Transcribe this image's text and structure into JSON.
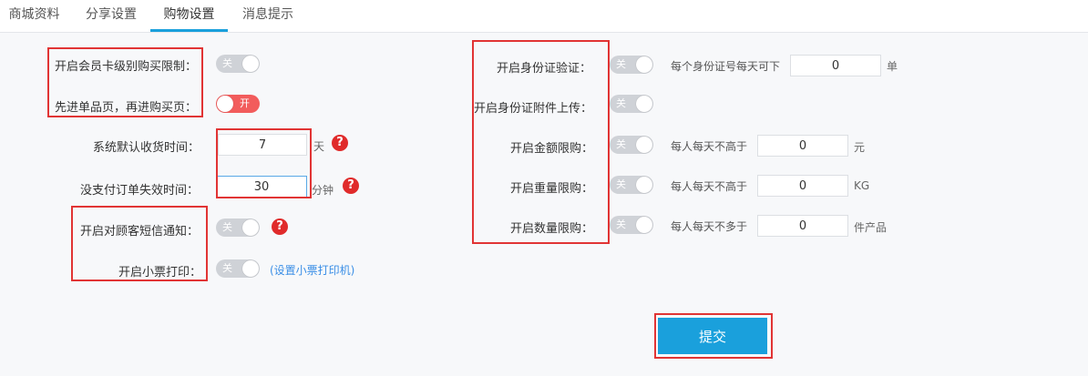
{
  "tabs": [
    {
      "label": "商城资料",
      "active": false
    },
    {
      "label": "分享设置",
      "active": false
    },
    {
      "label": "购物设置",
      "active": true
    },
    {
      "label": "消息提示",
      "active": false
    }
  ],
  "left": {
    "member_limit": {
      "label": "开启会员卡级别购买限制：",
      "toggle": "关",
      "state": "off"
    },
    "product_first": {
      "label": "先进单品页，再进购买页：",
      "toggle": "开",
      "state": "on"
    },
    "receive_time": {
      "label": "系统默认收货时间：",
      "value": "7",
      "unit": "天"
    },
    "unpaid_expire": {
      "label": "没支付订单失效时间：",
      "value": "30",
      "unit": "分钟"
    },
    "sms_notify": {
      "label": "开启对顾客短信通知：",
      "toggle": "关",
      "state": "off"
    },
    "receipt_print": {
      "label": "开启小票打印：",
      "toggle": "关",
      "state": "off",
      "link": "(设置小票打印机)"
    }
  },
  "right": {
    "id_verify": {
      "label": "开启身份证验证：",
      "toggle": "关",
      "state": "off",
      "desc": "每个身份证号每天可下",
      "value": "0",
      "unit": "单"
    },
    "id_upload": {
      "label": "开启身份证附件上传：",
      "toggle": "关",
      "state": "off"
    },
    "amount_limit": {
      "label": "开启金额限购：",
      "toggle": "关",
      "state": "off",
      "desc": "每人每天不高于",
      "value": "0",
      "unit": "元"
    },
    "weight_limit": {
      "label": "开启重量限购：",
      "toggle": "关",
      "state": "off",
      "desc": "每人每天不高于",
      "value": "0",
      "unit": "KG"
    },
    "qty_limit": {
      "label": "开启数量限购：",
      "toggle": "关",
      "state": "off",
      "desc": "每人每天不多于",
      "value": "0",
      "unit": "件产品"
    }
  },
  "help_glyph": "?",
  "submit_label": "提交",
  "colors": {
    "accent": "#1aa0dc",
    "highlight": "#e13434",
    "toggle_on": "#f25c5c",
    "toggle_off": "#cfd2d7",
    "help": "#e02b2b"
  }
}
